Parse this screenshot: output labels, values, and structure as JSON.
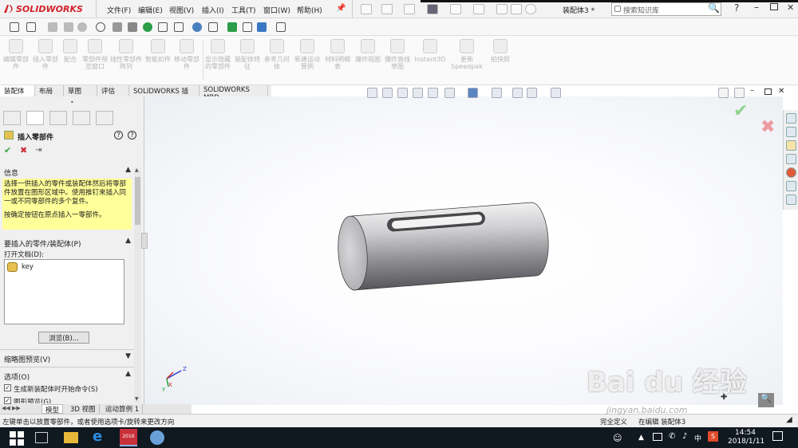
{
  "app": {
    "logo_text": "SOLIDWORKS",
    "doc_title": "装配体3 *",
    "brand_color": "#d3232a"
  },
  "menu": [
    {
      "label": "文件(F)"
    },
    {
      "label": "编辑(E)"
    },
    {
      "label": "视图(V)"
    },
    {
      "label": "插入(I)"
    },
    {
      "label": "工具(T)"
    },
    {
      "label": "窗口(W)"
    },
    {
      "label": "帮助(H)"
    }
  ],
  "search": {
    "placeholder": "搜索知识库"
  },
  "ribbon": [
    {
      "label": "编辑零部件"
    },
    {
      "label": "插入零部件"
    },
    {
      "label": "配合"
    },
    {
      "label": "零部件预览窗口"
    },
    {
      "label": "线性零部件阵列"
    },
    {
      "label": "智能扣件"
    },
    {
      "label": "移动零部件"
    },
    {
      "label": "显示隐藏的零部件"
    },
    {
      "label": "装配体特征"
    },
    {
      "label": "参考几何体"
    },
    {
      "label": "新建运动算例"
    },
    {
      "label": "材料明细表"
    },
    {
      "label": "爆炸视图"
    },
    {
      "label": "爆炸直线草图"
    },
    {
      "label": "Instant3D"
    },
    {
      "label": "更新Speedpak"
    },
    {
      "label": "拍快照"
    }
  ],
  "tabs": [
    {
      "label": "装配体"
    },
    {
      "label": "布局"
    },
    {
      "label": "草图"
    },
    {
      "label": "评估"
    },
    {
      "label": "SOLIDWORKS 插件"
    },
    {
      "label": "SOLIDWORKS MBD"
    }
  ],
  "panel": {
    "title": "插入零部件",
    "help_icon": "?",
    "info_heading": "信息",
    "info_text": "选择一供插入的零件或装配体然后将零部件放置在图形区域中。使用推钉来插入同一或不同零部件的多个复件。",
    "info_text2": "按确定按钮在原点插入一零部件。",
    "parts_heading": "要插入的零件/装配体(P)",
    "open_docs_label": "打开文档(D):",
    "list_items": [
      {
        "label": "key"
      }
    ],
    "browse_label": "浏览(B)...",
    "thumb_heading": "缩略图预览(V)",
    "options_heading": "选项(O)",
    "opt1": "生成新装配体时开始命令(S)",
    "opt2": "图形预览(G)"
  },
  "bottom_tabs": [
    {
      "label": "模型"
    },
    {
      "label": "3D 视图"
    },
    {
      "label": "运动算例 1"
    }
  ],
  "status": {
    "left": "左键单击以放置零部件，或者使用选项卡/旋转来更改方向",
    "right": "完全定义",
    "right2": "在编辑 装配体3"
  },
  "taskbar": {
    "time": "14:54",
    "date": "2018/1/11",
    "ime": "中",
    "sw_label": "2016"
  },
  "watermark": {
    "text": "Bai du 经验",
    "url": "jingyan.baidu.com"
  },
  "axis": {
    "x": "X",
    "y": "Y",
    "z": "Z"
  },
  "colors": {
    "ok": "#2ea043",
    "cancel": "#c8303a",
    "info_bg": "#ffff99"
  }
}
